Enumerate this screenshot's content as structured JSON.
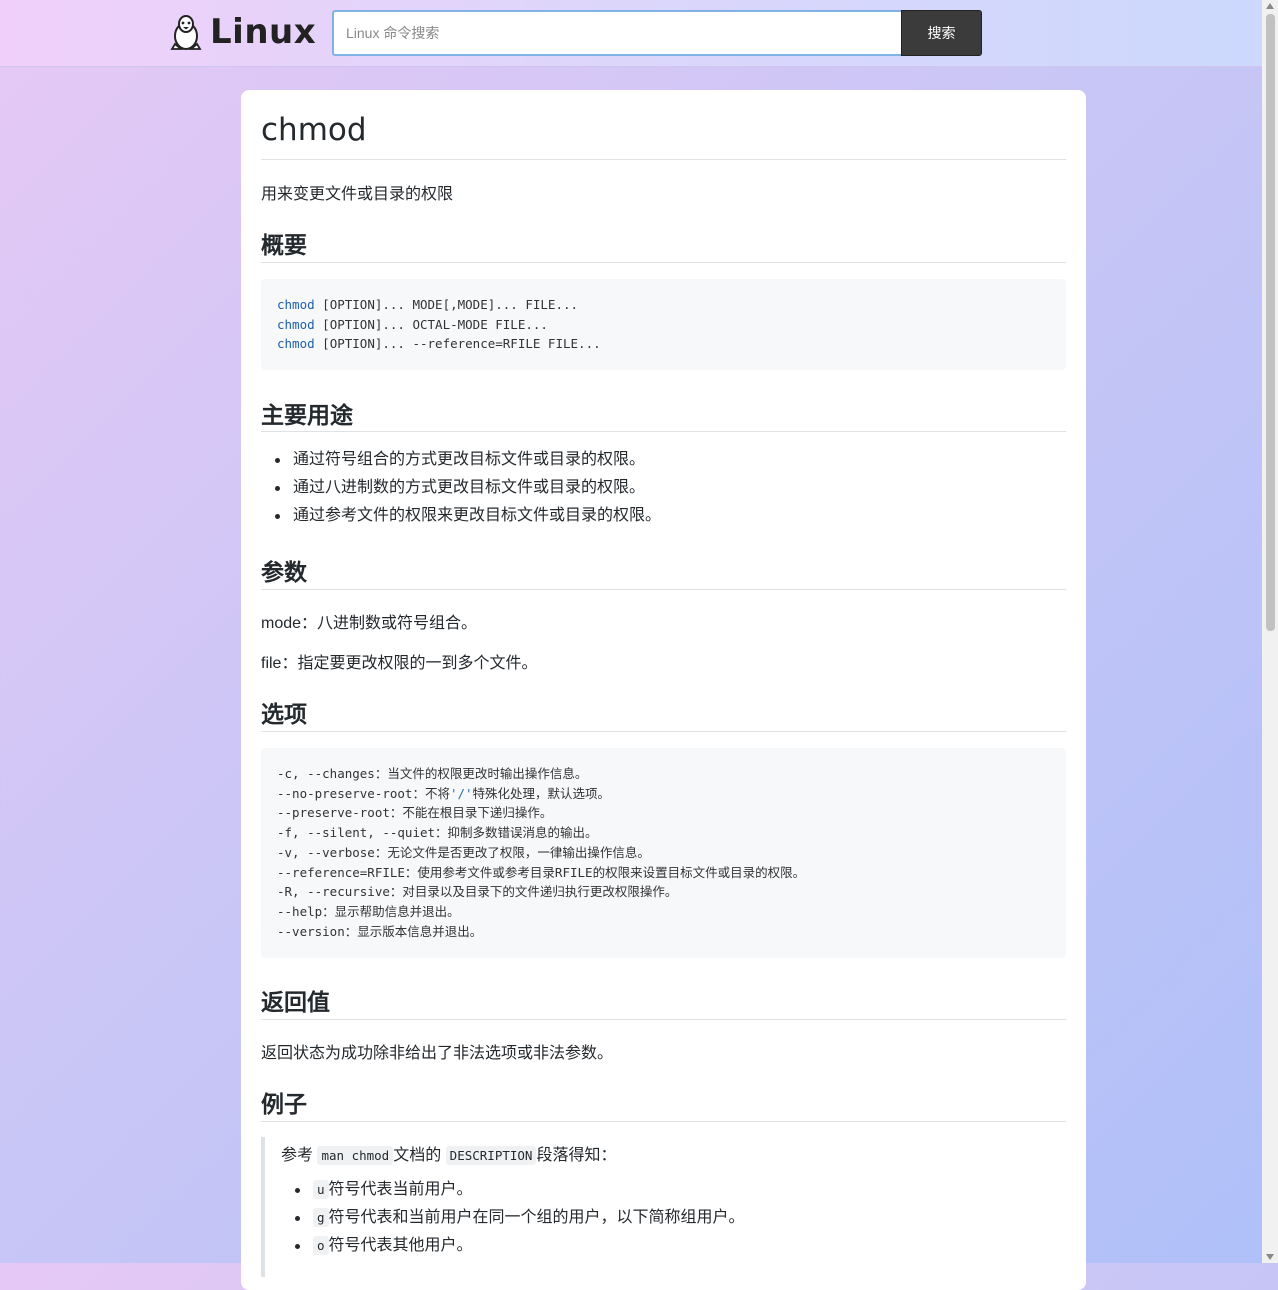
{
  "header": {
    "logo_text": "Linux",
    "search_placeholder": "Linux 命令搜索",
    "search_button": "搜索"
  },
  "article": {
    "title": "chmod",
    "subtitle": "用来变更文件或目录的权限",
    "sections": {
      "synopsis": {
        "heading": "概要",
        "lines": [
          {
            "cmd": "chmod",
            "rest": " [OPTION]... MODE[,MODE]... FILE..."
          },
          {
            "cmd": "chmod",
            "rest": " [OPTION]... OCTAL-MODE FILE..."
          },
          {
            "cmd": "chmod",
            "rest": " [OPTION]... --reference=RFILE FILE..."
          }
        ]
      },
      "usage": {
        "heading": "主要用途",
        "items": [
          "通过符号组合的方式更改目标文件或目录的权限。",
          "通过八进制数的方式更改目标文件或目录的权限。",
          "通过参考文件的权限来更改目标文件或目录的权限。"
        ]
      },
      "params": {
        "heading": "参数",
        "p1": "mode：八进制数或符号组合。",
        "p2": "file：指定要更改权限的一到多个文件。"
      },
      "options": {
        "heading": "选项",
        "line1": "-c, --changes：当文件的权限更改时输出操作信息。",
        "line2_a": "--no-preserve-root：不将",
        "line2_str": "'/'",
        "line2_b": "特殊化处理，默认选项。",
        "line3": "--preserve-root：不能在根目录下递归操作。",
        "line4": "-f, --silent, --quiet：抑制多数错误消息的输出。",
        "line5": "-v, --verbose：无论文件是否更改了权限，一律输出操作信息。",
        "line6": "--reference=RFILE：使用参考文件或参考目录RFILE的权限来设置目标文件或目录的权限。",
        "line7": "-R, --recursive：对目录以及目录下的文件递归执行更改权限操作。",
        "line8": "--help：显示帮助信息并退出。",
        "line9": "--version：显示版本信息并退出。"
      },
      "returns": {
        "heading": "返回值",
        "text": "返回状态为成功除非给出了非法选项或非法参数。"
      },
      "examples": {
        "heading": "例子",
        "intro_a": "参考",
        "intro_code1": "man chmod",
        "intro_b": "文档的",
        "intro_code2": "DESCRIPTION",
        "intro_c": "段落得知：",
        "items": [
          {
            "code": "u",
            "text": "符号代表当前用户。"
          },
          {
            "code": "g",
            "text": "符号代表和当前用户在同一个组的用户，以下简称组用户。"
          },
          {
            "code": "o",
            "text": "符号代表其他用户。"
          }
        ]
      }
    }
  }
}
